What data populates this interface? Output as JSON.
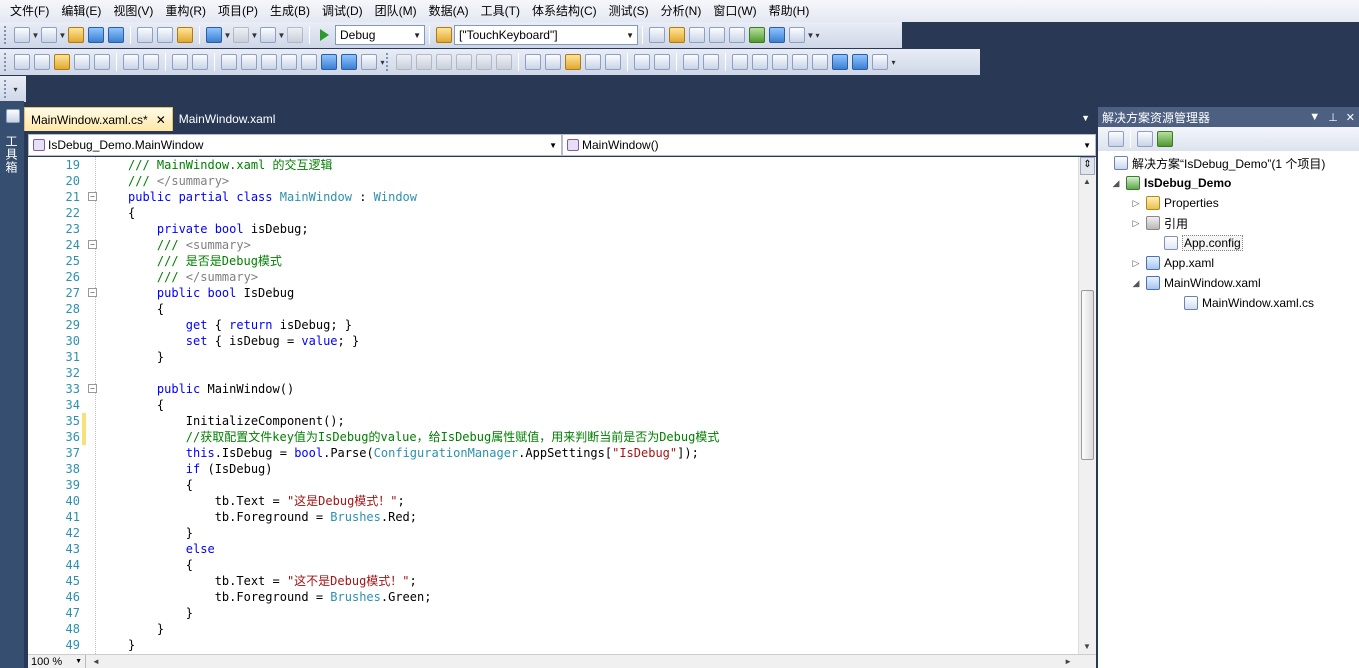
{
  "menu": [
    "文件(F)",
    "编辑(E)",
    "视图(V)",
    "重构(R)",
    "项目(P)",
    "生成(B)",
    "调试(D)",
    "团队(M)",
    "数据(A)",
    "工具(T)",
    "体系结构(C)",
    "测试(S)",
    "分析(N)",
    "窗口(W)",
    "帮助(H)"
  ],
  "toolbar": {
    "config_value": "Debug",
    "find_value": "[\"TouchKeyboard\"]"
  },
  "toolbox_label": "工具箱",
  "tabs": [
    {
      "label": "MainWindow.xaml.cs*",
      "close": "✕"
    },
    {
      "label": "MainWindow.xaml"
    }
  ],
  "navbar": {
    "type_value": "IsDebug_Demo.MainWindow",
    "member_value": "MainWindow()"
  },
  "code_lines": [
    {
      "num": "19",
      "tokens": [
        {
          "t": "/// MainWindow.xaml 的交互逻辑",
          "c": "c"
        }
      ]
    },
    {
      "num": "20",
      "tokens": [
        {
          "t": "/// ",
          "c": "c"
        },
        {
          "t": "</summary>",
          "c": "gy"
        }
      ]
    },
    {
      "num": "21",
      "tokens": [
        {
          "t": "public partial class ",
          "c": "k"
        },
        {
          "t": "MainWindow",
          "c": "y"
        },
        {
          "t": " : ",
          "c": ""
        },
        {
          "t": "Window",
          "c": "y"
        }
      ]
    },
    {
      "num": "22",
      "tokens": [
        {
          "t": "{",
          "c": ""
        }
      ]
    },
    {
      "num": "23",
      "tokens": [
        {
          "t": "    private bool ",
          "c": "k"
        },
        {
          "t": "isDebug;",
          "c": ""
        }
      ]
    },
    {
      "num": "24",
      "tokens": [
        {
          "t": "    /// ",
          "c": "c"
        },
        {
          "t": "<summary>",
          "c": "gy"
        }
      ]
    },
    {
      "num": "25",
      "tokens": [
        {
          "t": "    /// 是否是Debug模式",
          "c": "c"
        }
      ]
    },
    {
      "num": "26",
      "tokens": [
        {
          "t": "    /// ",
          "c": "c"
        },
        {
          "t": "</summary>",
          "c": "gy"
        }
      ]
    },
    {
      "num": "27",
      "tokens": [
        {
          "t": "    public bool ",
          "c": "k"
        },
        {
          "t": "IsDebug",
          "c": ""
        }
      ]
    },
    {
      "num": "28",
      "tokens": [
        {
          "t": "    {",
          "c": ""
        }
      ]
    },
    {
      "num": "29",
      "tokens": [
        {
          "t": "        get",
          "c": "k"
        },
        {
          "t": " { ",
          "c": ""
        },
        {
          "t": "return",
          "c": "k"
        },
        {
          "t": " isDebug; }",
          "c": ""
        }
      ]
    },
    {
      "num": "30",
      "tokens": [
        {
          "t": "        set",
          "c": "k"
        },
        {
          "t": " { isDebug = ",
          "c": ""
        },
        {
          "t": "value",
          "c": "k"
        },
        {
          "t": "; }",
          "c": ""
        }
      ]
    },
    {
      "num": "31",
      "tokens": [
        {
          "t": "    }",
          "c": ""
        }
      ]
    },
    {
      "num": "32",
      "tokens": []
    },
    {
      "num": "33",
      "tokens": [
        {
          "t": "    public ",
          "c": "k"
        },
        {
          "t": "MainWindow()",
          "c": ""
        }
      ]
    },
    {
      "num": "34",
      "tokens": [
        {
          "t": "    {",
          "c": ""
        }
      ]
    },
    {
      "num": "35",
      "tokens": [
        {
          "t": "        InitializeComponent();",
          "c": ""
        }
      ]
    },
    {
      "num": "36",
      "tokens": [
        {
          "t": "        //获取配置文件key值为IsDebug的value，给IsDebug属性赋值，用来判断当前是否为Debug模式",
          "c": "c"
        }
      ]
    },
    {
      "num": "37",
      "tokens": [
        {
          "t": "        this",
          "c": "k"
        },
        {
          "t": ".IsDebug = ",
          "c": ""
        },
        {
          "t": "bool",
          "c": "k"
        },
        {
          "t": ".Parse(",
          "c": ""
        },
        {
          "t": "ConfigurationManager",
          "c": "y"
        },
        {
          "t": ".AppSettings[",
          "c": ""
        },
        {
          "t": "\"IsDebug\"",
          "c": "s"
        },
        {
          "t": "]);",
          "c": ""
        }
      ]
    },
    {
      "num": "38",
      "tokens": [
        {
          "t": "        if",
          "c": "k"
        },
        {
          "t": " (IsDebug)",
          "c": ""
        }
      ]
    },
    {
      "num": "39",
      "tokens": [
        {
          "t": "        {",
          "c": ""
        }
      ]
    },
    {
      "num": "40",
      "tokens": [
        {
          "t": "            tb.Text = ",
          "c": ""
        },
        {
          "t": "\"这是Debug模式！\"",
          "c": "s"
        },
        {
          "t": ";",
          "c": ""
        }
      ]
    },
    {
      "num": "41",
      "tokens": [
        {
          "t": "            tb.Foreground = ",
          "c": ""
        },
        {
          "t": "Brushes",
          "c": "y"
        },
        {
          "t": ".Red;",
          "c": ""
        }
      ]
    },
    {
      "num": "42",
      "tokens": [
        {
          "t": "        }",
          "c": ""
        }
      ]
    },
    {
      "num": "43",
      "tokens": [
        {
          "t": "        else",
          "c": "k"
        }
      ]
    },
    {
      "num": "44",
      "tokens": [
        {
          "t": "        {",
          "c": ""
        }
      ]
    },
    {
      "num": "45",
      "tokens": [
        {
          "t": "            tb.Text = ",
          "c": ""
        },
        {
          "t": "\"这不是Debug模式！\"",
          "c": "s"
        },
        {
          "t": ";",
          "c": ""
        }
      ]
    },
    {
      "num": "46",
      "tokens": [
        {
          "t": "            tb.Foreground = ",
          "c": ""
        },
        {
          "t": "Brushes",
          "c": "y"
        },
        {
          "t": ".Green;",
          "c": ""
        }
      ]
    },
    {
      "num": "47",
      "tokens": [
        {
          "t": "        }",
          "c": ""
        }
      ]
    },
    {
      "num": "48",
      "tokens": [
        {
          "t": "    }",
          "c": ""
        }
      ]
    },
    {
      "num": "49",
      "tokens": [
        {
          "t": "}",
          "c": ""
        }
      ]
    }
  ],
  "status": {
    "zoom": "100 %"
  },
  "solution": {
    "title": "解决方案资源管理器",
    "items": [
      {
        "label": "解决方案“IsDebug_Demo”(1 个项目)",
        "icon": "solution-icon"
      },
      {
        "label": "IsDebug_Demo",
        "icon": "project-icon",
        "bold": true
      },
      {
        "label": "Properties",
        "icon": "properties-folder-icon"
      },
      {
        "label": "引用",
        "icon": "references-icon"
      },
      {
        "label": "App.config",
        "icon": "config-file-icon"
      },
      {
        "label": "App.xaml",
        "icon": "xaml-file-icon"
      },
      {
        "label": "MainWindow.xaml",
        "icon": "xaml-file-icon"
      },
      {
        "label": "MainWindow.xaml.cs",
        "icon": "cs-file-icon"
      }
    ]
  }
}
